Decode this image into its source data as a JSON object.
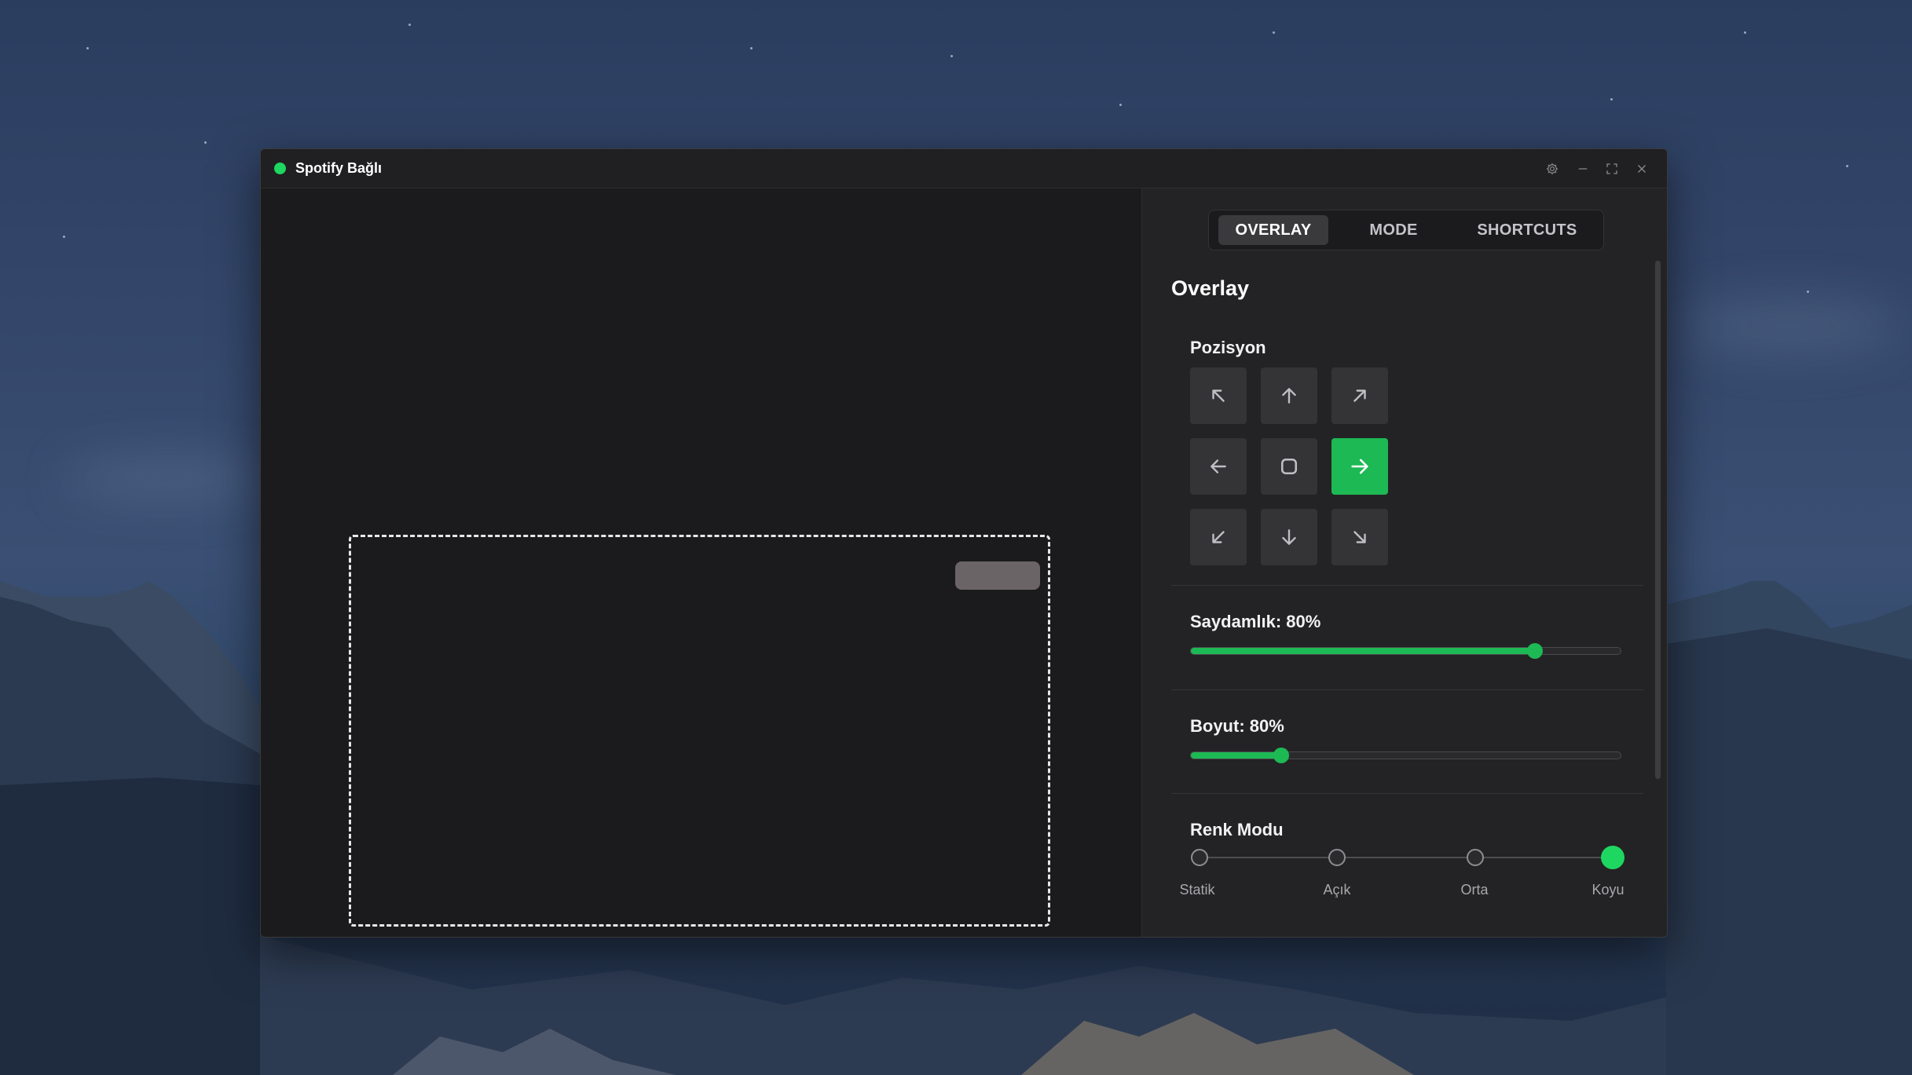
{
  "window": {
    "title": "Spotify Bağlı",
    "status_color": "#1ed760"
  },
  "titlebar": {
    "icons": [
      "gear-icon",
      "minimize-icon",
      "maximize-icon",
      "close-icon"
    ]
  },
  "tabs": [
    {
      "label": "OVERLAY",
      "active": true
    },
    {
      "label": "MODE",
      "active": false
    },
    {
      "label": "SHORTCUTS",
      "active": false
    }
  ],
  "overlay": {
    "title": "Overlay",
    "position": {
      "label": "Pozisyon",
      "selected": "right",
      "buttons": [
        "top-left",
        "top",
        "top-right",
        "left",
        "center",
        "right",
        "bottom-left",
        "bottom",
        "bottom-right"
      ]
    },
    "opacity": {
      "label": "Saydamlık: 80%",
      "value": 0.8
    },
    "size": {
      "label": "Boyut: 80%",
      "value": 0.8,
      "thumb_fraction": 0.21
    },
    "color_mode": {
      "label": "Renk Modu",
      "options": [
        "Statik",
        "Açık",
        "Orta",
        "Koyu"
      ],
      "selected": 3
    }
  },
  "accent_color": "#1db954"
}
